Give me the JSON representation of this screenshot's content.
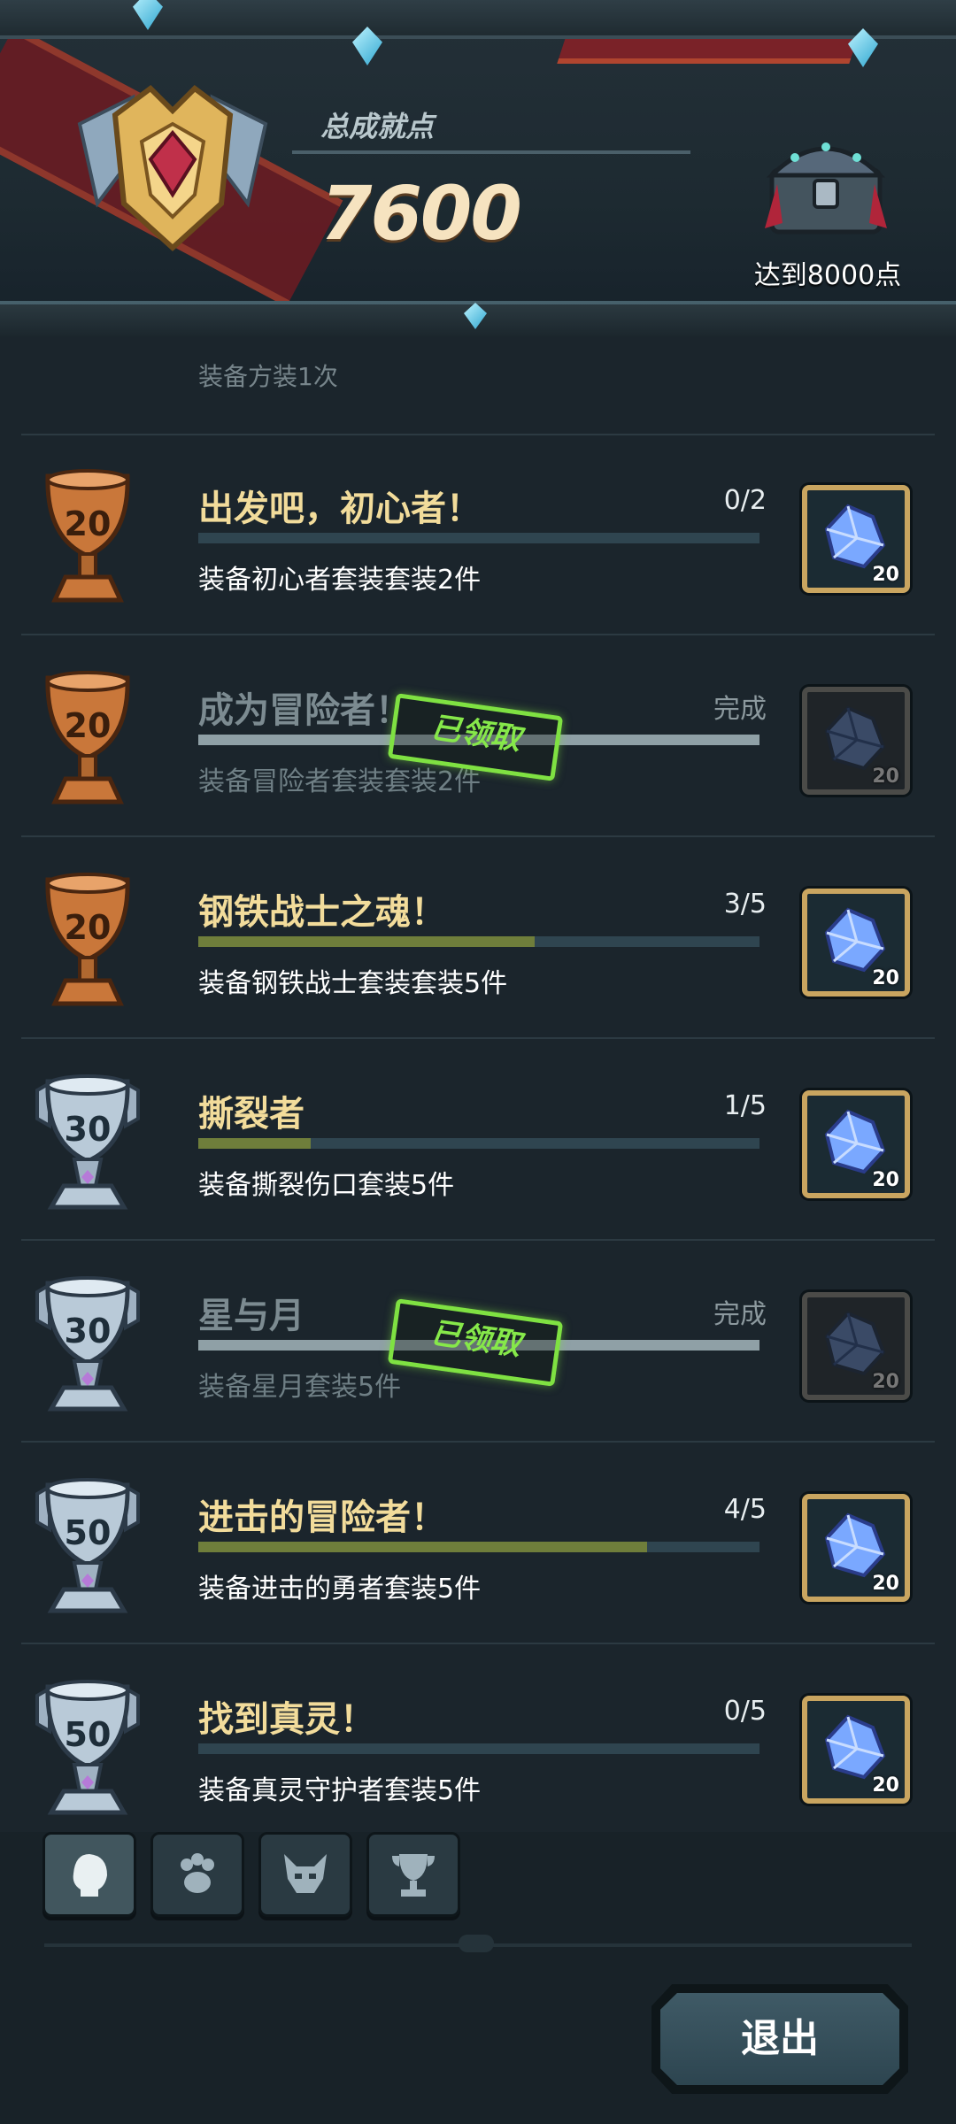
{
  "header": {
    "total_label": "总成就点",
    "total_value": "7600",
    "chest_label": "达到8000点"
  },
  "partial_row": {
    "desc": "装备方装1次"
  },
  "achievements": [
    {
      "trophy": "bronze",
      "points": "20",
      "title": "出发吧，初心者！",
      "progress": "0/2",
      "fraction": 0.0,
      "desc": "装备初心者套装套装2件",
      "reward_count": "20",
      "claimed": false
    },
    {
      "trophy": "bronze",
      "points": "20",
      "title": "成为冒险者！",
      "progress": "完成",
      "fraction": 1.0,
      "desc": "装备冒险者套装套装2件",
      "reward_count": "20",
      "claimed": true,
      "stamp": "已领取"
    },
    {
      "trophy": "bronze",
      "points": "20",
      "title": "钢铁战士之魂！",
      "progress": "3/5",
      "fraction": 0.6,
      "desc": "装备钢铁战士套装套装5件",
      "reward_count": "20",
      "claimed": false
    },
    {
      "trophy": "silver",
      "points": "30",
      "title": "撕裂者",
      "progress": "1/5",
      "fraction": 0.2,
      "desc": "装备撕裂伤口套装5件",
      "reward_count": "20",
      "claimed": false
    },
    {
      "trophy": "silver",
      "points": "30",
      "title": "星与月",
      "progress": "完成",
      "fraction": 1.0,
      "desc": "装备星月套装5件",
      "reward_count": "20",
      "claimed": true,
      "stamp": "已领取"
    },
    {
      "trophy": "silver",
      "points": "50",
      "title": "进击的冒险者！",
      "progress": "4/5",
      "fraction": 0.8,
      "desc": "装备进击的勇者套装5件",
      "reward_count": "20",
      "claimed": false
    },
    {
      "trophy": "silver",
      "points": "50",
      "title": "找到真灵！",
      "progress": "0/5",
      "fraction": 0.0,
      "desc": "装备真灵守护者套装5件",
      "reward_count": "20",
      "claimed": false
    }
  ],
  "tabs": [
    {
      "icon": "hero-head-icon",
      "active": true
    },
    {
      "icon": "paw-icon",
      "active": false
    },
    {
      "icon": "demon-mask-icon",
      "active": false
    },
    {
      "icon": "trophy-icon",
      "active": false
    }
  ],
  "footer": {
    "exit_label": "退出"
  },
  "colors": {
    "background": "#18232a",
    "title_gold": "#f2dc9b",
    "progress_fill": "#6f7e3b",
    "stamp_green": "#86e84a",
    "reward_border": "#c9a560"
  }
}
